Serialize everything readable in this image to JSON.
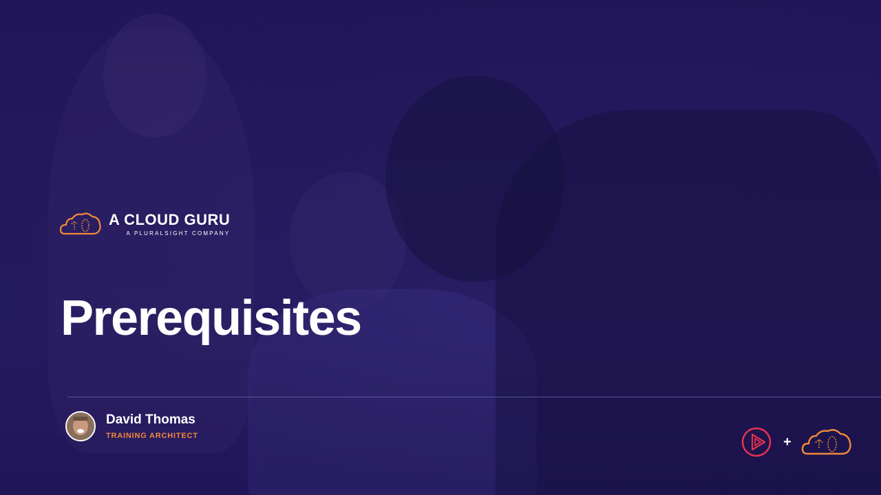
{
  "slide": {
    "title": "Prerequisites"
  },
  "logo": {
    "name": "A CLOUD GURU",
    "tagline": "A PLURALSIGHT COMPANY",
    "icon": "cloud-guru-icon"
  },
  "presenter": {
    "name": "David Thomas",
    "role": "TRAINING ARCHITECT"
  },
  "brand_lockup": {
    "plus": "+",
    "icons": [
      "pluralsight-icon",
      "cloud-guru-icon"
    ]
  },
  "colors": {
    "background": "#26195e",
    "accent_orange": "#f4883b",
    "pluralsight_red": "#e8304f",
    "text": "#ffffff"
  }
}
